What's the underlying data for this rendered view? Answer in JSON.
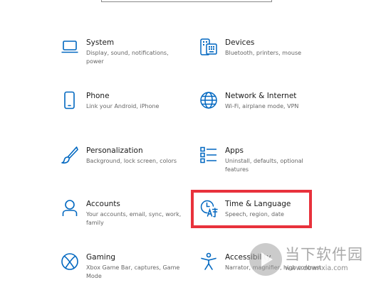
{
  "settings": {
    "accent_color": "#0067c0",
    "highlight_color": "#e8323c",
    "tiles": [
      {
        "title": "System",
        "desc": "Display, sound, notifications, power",
        "icon": "laptop-icon"
      },
      {
        "title": "Devices",
        "desc": "Bluetooth, printers, mouse",
        "icon": "keyboard-icon"
      },
      {
        "title": "Phone",
        "desc": "Link your Android, iPhone",
        "icon": "phone-icon"
      },
      {
        "title": "Network & Internet",
        "desc": "Wi-Fi, airplane mode, VPN",
        "icon": "globe-icon"
      },
      {
        "title": "Personalization",
        "desc": "Background, lock screen, colors",
        "icon": "brush-icon"
      },
      {
        "title": "Apps",
        "desc": "Uninstall, defaults, optional features",
        "icon": "apps-list-icon"
      },
      {
        "title": "Accounts",
        "desc": "Your accounts, email, sync, work, family",
        "icon": "person-icon"
      },
      {
        "title": "Time & Language",
        "desc": "Speech, region, date",
        "icon": "time-language-icon"
      },
      {
        "title": "Gaming",
        "desc": "Xbox Game Bar, captures, Game Mode",
        "icon": "xbox-icon"
      },
      {
        "title": "Accessibility",
        "desc": "Narrator, magnifier, high contrast",
        "icon": "accessibility-icon"
      }
    ]
  },
  "watermark": {
    "text": "当下软件园",
    "url": "www.downxia.com"
  }
}
